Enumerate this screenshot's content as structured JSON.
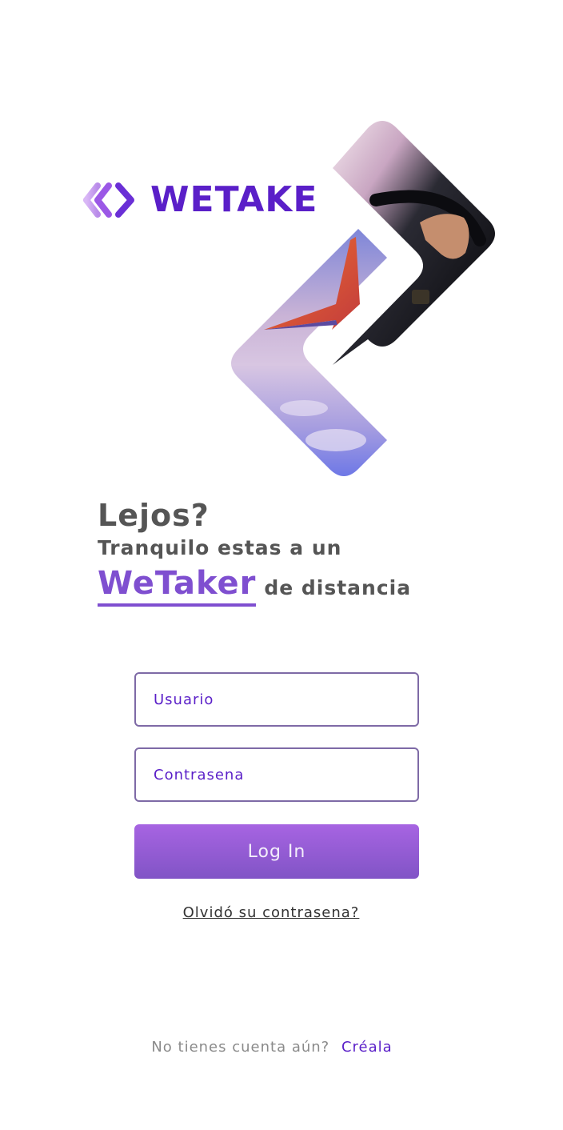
{
  "brand": {
    "name": "WETAKE",
    "logo_icon": "double-chevron-logo-icon",
    "primary_color": "#5a1fc8",
    "accent_color": "#7f4fd0"
  },
  "hero": {
    "icon": "chevron-photo-collage"
  },
  "tagline": {
    "title": "Lejos?",
    "line2": "Tranquilo estas a un",
    "brand_word": "WeTaker",
    "suffix": "de distancia"
  },
  "form": {
    "username_placeholder": "Usuario",
    "password_placeholder": "Contrasena",
    "login_label": "Log In",
    "forgot_label": "Olvidó su contrasena?"
  },
  "signup": {
    "question": "No tienes cuenta aún?",
    "link_label": "Créala"
  }
}
